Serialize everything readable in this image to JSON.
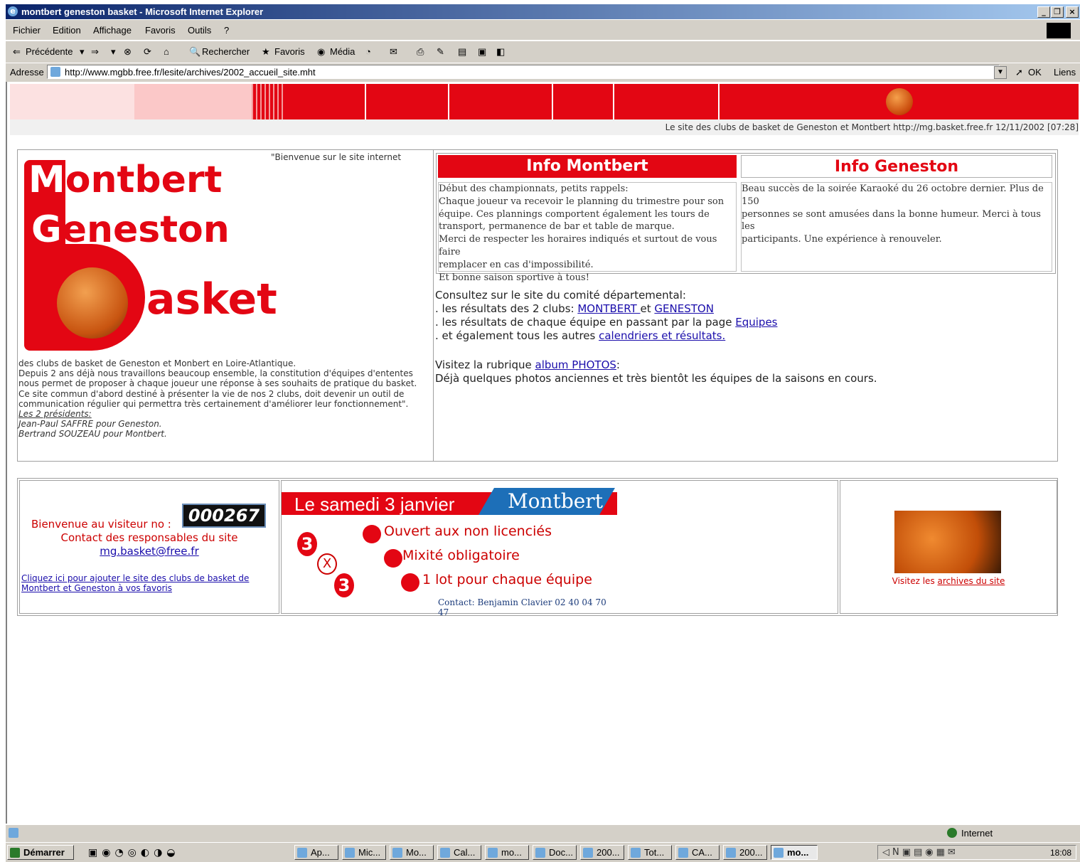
{
  "window": {
    "title": "montbert geneston basket - Microsoft Internet Explorer",
    "controls": [
      "_",
      "è",
      "×"
    ]
  },
  "menubar": [
    "Fichier",
    "Edition",
    "Affichage",
    "Favoris",
    "Outils",
    "?"
  ],
  "toolbar": {
    "back": "Précédente",
    "search": "Rechercher",
    "favorites": "Favoris",
    "media": "Média"
  },
  "address": {
    "label": "Adresse",
    "url": "http://www.mgbb.free.fr/lesite/archives/2002_accueil_site.mht",
    "go": "OK",
    "links": "Liens"
  },
  "site": {
    "strip_text": "Le site des clubs de basket de Geneston et Montbert http://mg.basket.free.fr 12/11/2002 [07:28]",
    "logo": {
      "l1_cap": "M",
      "l1_rest": "ontbert",
      "l2_cap": "G",
      "l2_rest": "eneston",
      "l3_rest": "asket"
    },
    "welcome_quote": "\"Bienvenue sur le site internet",
    "left_text": {
      "p1": "des clubs de basket de Geneston et Monbert en Loire-Atlantique.",
      "p2": "Depuis 2 ans déjà nous travaillons beaucoup ensemble, la constitution d'équipes d'ententes nous permet de proposer à chaque joueur une réponse à ses souhaits de pratique du basket.",
      "p3": "Ce site commun d'abord destiné à présenter la vie de nos 2 clubs, doit devenir un outil de communication régulier qui permettra très certainement d'améliorer leur fonctionnement\".",
      "presidents_label": "Les 2 présidents:",
      "pres1": "Jean-Paul SAFFRE pour Geneston.",
      "pres2": "Bertrand SOUZEAU pour Montbert."
    },
    "info_montbert": {
      "title": "Info Montbert",
      "lines": [
        "Début des championnats, petits rappels:",
        "Chaque joueur va recevoir le planning du trimestre pour son",
        "équipe. Ces plannings comportent également les tours de",
        "transport, permanence de bar et table de marque.",
        "Merci de respecter les horaires indiqués et surtout de vous faire",
        "remplacer en cas d'impossibilité.",
        "Et bonne saison sportive à tous!"
      ]
    },
    "info_geneston": {
      "title": "Info Geneston",
      "lines": [
        "Beau succès de la soirée Karaoké du 26 octobre dernier. Plus de 150",
        "personnes se sont amusées dans la bonne humeur. Merci à tous les",
        "participants. Une expérience à renouveler."
      ]
    },
    "consult": {
      "intro": "Consultez sur le site du comité départemental:",
      "l1_pre": ". les résultats des 2 clubs: ",
      "l1_link1": "MONTBERT ",
      "l1_mid": "et ",
      "l1_link2": "GENESTON",
      "l2_pre": ". les résultats de chaque équipe en passant par la page ",
      "l2_link": "Equipes",
      "l3_pre": ". et également tous les autres ",
      "l3_link": "calendriers et résultats.",
      "photos_pre": "Visitez la rubrique ",
      "photos_link": "album PHOTOS",
      "photos_post": ":",
      "photos_text": "Déjà quelques photos anciennes et très bientôt les équipes de la saisons en cours."
    },
    "bottom": {
      "visitor_label": "Bienvenue au visiteur no :",
      "counter": "000267",
      "contact_label": "Contact des responsables du site",
      "email": "mg.basket@free.fr",
      "favorites_link": "Cliquez ici pour ajouter le site des clubs de basket de Montbert et Geneston à vos favoris",
      "flyer": {
        "date": "Le samedi 3 janvier",
        "place": "Montbert",
        "item1": "Ouvert aux non licenciés",
        "item2": "Mixité obligatoire",
        "item3": "1 lot pour chaque équipe",
        "badge_a": "3",
        "badge_x": "X",
        "badge_b": "3",
        "contact": "Contact: Benjamin Clavier 02 40 04 70 47"
      },
      "archives_pre": "Visitez les ",
      "archives_link": "archives du site"
    }
  },
  "statusbar": {
    "zone": "Internet"
  },
  "taskbar": {
    "start": "Démarrer",
    "tasks": [
      "Ap...",
      "Mic...",
      "Mo...",
      "Cal...",
      "mo...",
      "Doc...",
      "200...",
      "Tot...",
      "CA...",
      "200...",
      "mo..."
    ],
    "clock": "18:08"
  }
}
